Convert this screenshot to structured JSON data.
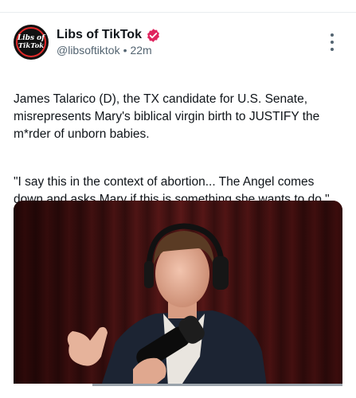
{
  "post": {
    "author": {
      "display_name": "Libs of TikTok",
      "handle": "@libsoftiktok",
      "avatar_text_line1": "Libs of",
      "avatar_text_line2": "TikTok",
      "verified": true
    },
    "separator": "•",
    "time_ago": "22m",
    "text_paragraph_1": "James Talarico (D), the TX candidate for U.S. Senate, misrepresents Mary's biblical virgin birth to JUSTIFY the m*rder of unborn babies.",
    "text_paragraph_2": "\"I say this in the context of abortion... The Angel comes down and asks Mary if this is something she wants to do.\"",
    "media": {
      "type": "video",
      "progress_fraction": 0.24
    }
  },
  "icons": {
    "verified": "verified-badge-icon",
    "more": "more-vertical-icon"
  },
  "colors": {
    "verified": "#e0245e",
    "text": "#0f1419",
    "secondary": "#536471",
    "curtain": "#4a1212"
  }
}
